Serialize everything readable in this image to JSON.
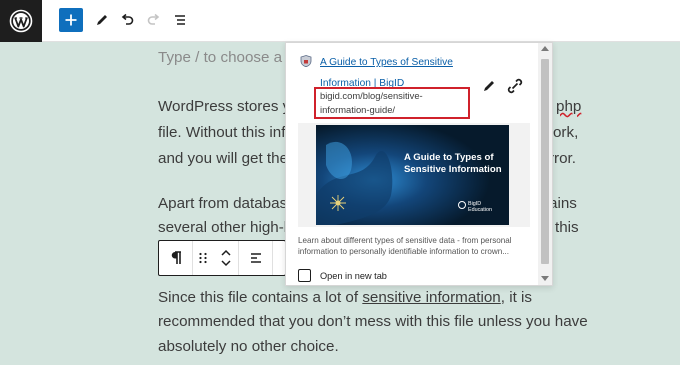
{
  "toolbar": {
    "icons": [
      "wordpress-logo",
      "add-block",
      "edit-pencil",
      "undo",
      "redo",
      "list-view"
    ]
  },
  "editor": {
    "placeholder": "Type / to choose a b",
    "p1_l1_left": "WordPress stores yo",
    "p1_l1_right": "php",
    "p1_l2_left": "file. Without this inf",
    "p1_l2_right": "work,",
    "p1_l3_left": "and you will get the",
    "p1_l3_right": "rror.",
    "p2_l1_left": "Apart from databas",
    "p2_l1_right": "ains",
    "p2_l2_left": "several other high-l",
    "p2_l2_right": "this",
    "p3_l1_before": "Since this file contains a lot of ",
    "p3_l1_link": "sensitive information",
    "p3_l1_after": ", it is",
    "p3_l2": "recommended that you don’t mess with this file unless you have",
    "p3_l3": "absolutely no other choice."
  },
  "link_popover": {
    "title": "A Guide to Types of Sensitive Information | BigID",
    "url": "bigid.com/blog/sensitive-information-guide/",
    "preview_title": "A Guide to Types of Sensitive Information",
    "preview_brand": "BigID Education",
    "description": "Learn about different types of sensitive data - from personal information to personally identifiable information to crown...",
    "open_new_tab_label": "Open in new tab",
    "open_new_tab_checked": false,
    "highlight_color": "#d0212b",
    "link_color": "#0a5fa8"
  },
  "colors": {
    "page_bg": "#d4e4de",
    "add_button": "#0f6fbd",
    "logo_bg": "#1e1e1e"
  }
}
